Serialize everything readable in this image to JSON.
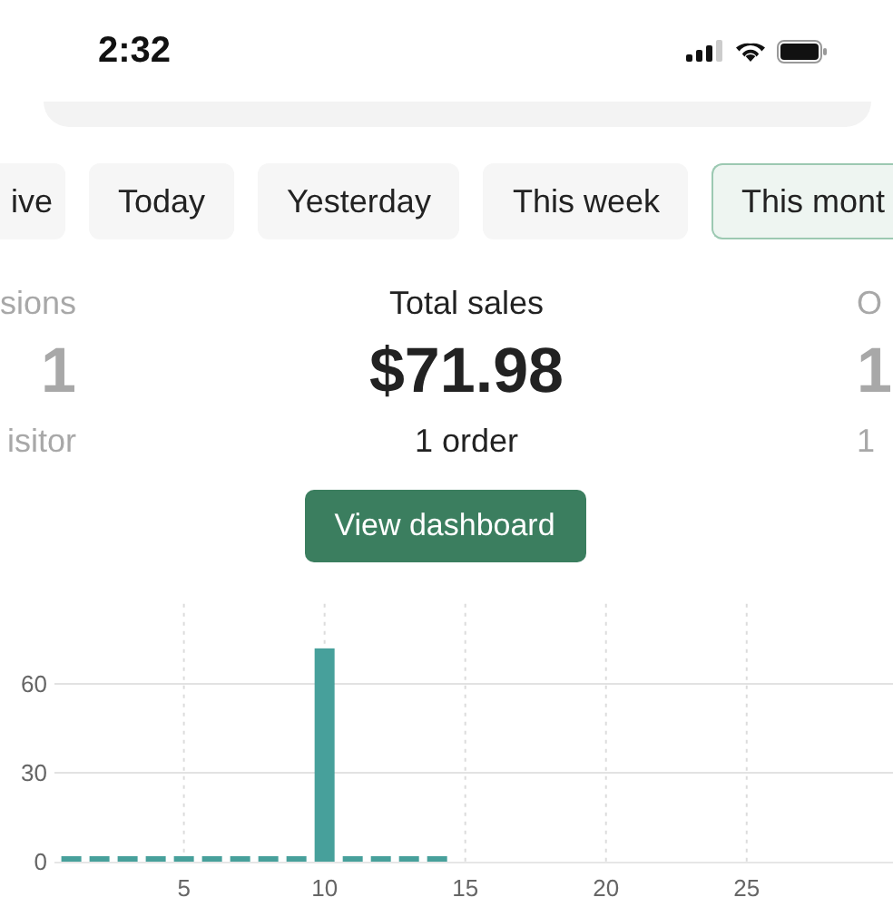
{
  "status_bar": {
    "time": "2:32"
  },
  "tabs": [
    {
      "label": "ive",
      "selected": false
    },
    {
      "label": "Today",
      "selected": false
    },
    {
      "label": "Yesterday",
      "selected": false
    },
    {
      "label": "This week",
      "selected": false
    },
    {
      "label": "This mont",
      "selected": true
    }
  ],
  "metrics": [
    {
      "label": "sions",
      "value": "1",
      "sublabel": "isitor",
      "selected": false
    },
    {
      "label": "Total sales",
      "value": "$71.98",
      "sublabel": "1 order",
      "selected": true
    },
    {
      "label": "O",
      "value": "1",
      "sublabel": "1",
      "selected": false
    }
  ],
  "button": "View dashboard",
  "chart_data": {
    "type": "bar",
    "x": [
      1,
      2,
      3,
      4,
      5,
      6,
      7,
      8,
      9,
      10,
      11,
      12,
      13,
      14
    ],
    "series": [
      {
        "color": "#47a09b",
        "values": [
          0,
          0,
          0,
          0,
          0,
          0,
          0,
          0,
          0,
          72,
          0,
          0,
          0,
          0
        ]
      }
    ],
    "xlim": [
      0.4,
      30.2
    ],
    "ylim": [
      0,
      87
    ],
    "yticks": [
      0,
      30,
      60
    ],
    "xticks": [
      5,
      10,
      15,
      20,
      25
    ],
    "grid": true
  }
}
